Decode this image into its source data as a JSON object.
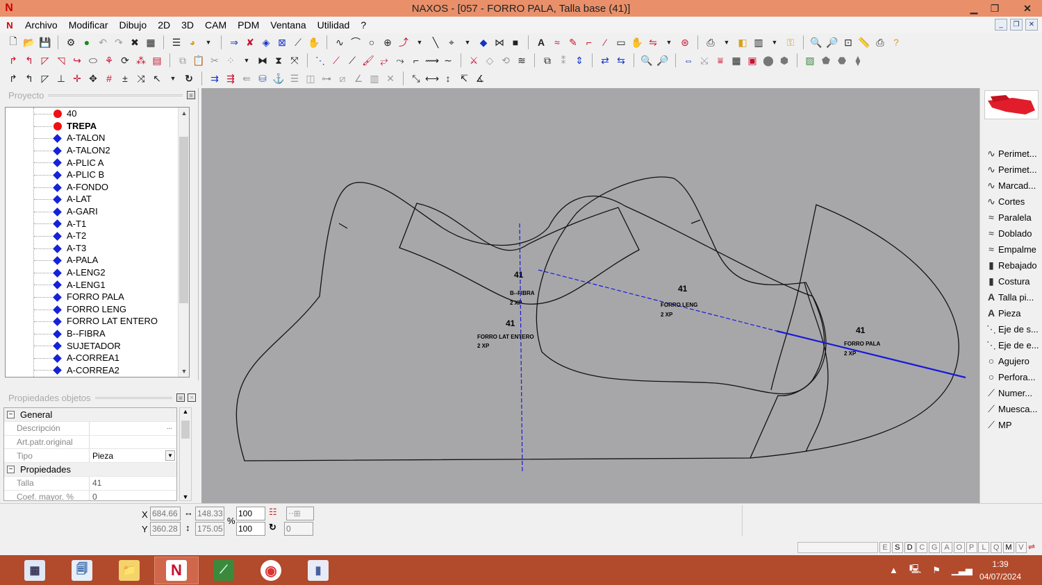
{
  "window": {
    "title": "NAXOS - [057 - FORRO PALA, Talla base (41)]",
    "app_icon": "N"
  },
  "menu": [
    "Archivo",
    "Modificar",
    "Dibujo",
    "2D",
    "3D",
    "CAM",
    "PDM",
    "Ventana",
    "Utilidad",
    "?"
  ],
  "project_panel": {
    "title": "Proyecto",
    "items": [
      {
        "label": "40",
        "marker": "red-dot",
        "bold": false
      },
      {
        "label": "TREPA",
        "marker": "red-dot",
        "bold": true
      },
      {
        "label": "A-TALON",
        "marker": "blue-diamond",
        "bold": false
      },
      {
        "label": "A-TALON2",
        "marker": "blue-diamond",
        "bold": false
      },
      {
        "label": "A-PLIC A",
        "marker": "blue-diamond",
        "bold": false
      },
      {
        "label": "A-PLIC B",
        "marker": "blue-diamond",
        "bold": false
      },
      {
        "label": "A-FONDO",
        "marker": "blue-diamond",
        "bold": false
      },
      {
        "label": "A-LAT",
        "marker": "blue-diamond",
        "bold": false
      },
      {
        "label": "A-GARI",
        "marker": "blue-diamond",
        "bold": false
      },
      {
        "label": "A-T1",
        "marker": "blue-diamond",
        "bold": false
      },
      {
        "label": "A-T2",
        "marker": "blue-diamond",
        "bold": false
      },
      {
        "label": "A-T3",
        "marker": "blue-diamond",
        "bold": false
      },
      {
        "label": "A-PALA",
        "marker": "blue-diamond",
        "bold": false
      },
      {
        "label": "A-LENG2",
        "marker": "blue-diamond",
        "bold": false
      },
      {
        "label": "A-LENG1",
        "marker": "blue-diamond",
        "bold": false
      },
      {
        "label": "FORRO PALA",
        "marker": "blue-diamond",
        "bold": false
      },
      {
        "label": "FORRO LENG",
        "marker": "blue-diamond",
        "bold": false
      },
      {
        "label": "FORRO LAT ENTERO",
        "marker": "blue-diamond",
        "bold": false
      },
      {
        "label": "B--FIBRA",
        "marker": "blue-diamond",
        "bold": false
      },
      {
        "label": "SUJETADOR",
        "marker": "blue-diamond",
        "bold": false
      },
      {
        "label": "A-CORREA1",
        "marker": "blue-diamond",
        "bold": false
      },
      {
        "label": "A-CORREA2",
        "marker": "blue-diamond",
        "bold": false
      }
    ]
  },
  "properties_panel": {
    "title": "Propiedades objetos",
    "rows": [
      {
        "type": "group",
        "label": "General"
      },
      {
        "type": "field",
        "name": "Descripción",
        "value": "",
        "control": "dots"
      },
      {
        "type": "field",
        "name": "Art.patr.original",
        "value": ""
      },
      {
        "type": "field",
        "name": "Tipo",
        "value": "Pieza",
        "control": "dropdown"
      },
      {
        "type": "group",
        "label": "Propiedades"
      },
      {
        "type": "field",
        "name": "Talla",
        "value": "41"
      },
      {
        "type": "field",
        "name": "Coef. mayor. %",
        "value": "0"
      }
    ]
  },
  "canvas": {
    "pieces": [
      {
        "size": "41",
        "name": "B--FIBRA",
        "qty": "2 XP"
      },
      {
        "size": "41",
        "name": "FORRO LAT ENTERO",
        "qty": "2 XP"
      },
      {
        "size": "41",
        "name": "FORRO LENG",
        "qty": "2 XP"
      },
      {
        "size": "41",
        "name": "FORRO PALA",
        "qty": "2 XP"
      }
    ],
    "colors": {
      "background": "#a7a7aa",
      "outline": "#111111",
      "axis": "#1a1ad8"
    }
  },
  "right_panel": {
    "tools": [
      {
        "label": "Perimet...",
        "icon": "curve-icon"
      },
      {
        "label": "Perimet...",
        "icon": "curve-icon"
      },
      {
        "label": "Marcad...",
        "icon": "curve-icon"
      },
      {
        "label": "Cortes",
        "icon": "curve-icon"
      },
      {
        "label": "Paralela",
        "icon": "parallel-icon"
      },
      {
        "label": "Doblado",
        "icon": "fold-icon"
      },
      {
        "label": "Empalme",
        "icon": "join-icon"
      },
      {
        "label": "Rebajado",
        "icon": "skive-icon"
      },
      {
        "label": "Costura",
        "icon": "seam-icon"
      },
      {
        "label": "Talla pi...",
        "icon": "text-icon"
      },
      {
        "label": "Pieza",
        "icon": "text-icon"
      },
      {
        "label": "Eje de s...",
        "icon": "axis-icon"
      },
      {
        "label": "Eje de e...",
        "icon": "axis-icon"
      },
      {
        "label": "Agujero",
        "icon": "circle-icon"
      },
      {
        "label": "Perfora...",
        "icon": "circle-icon"
      },
      {
        "label": "Numer...",
        "icon": "notch-icon"
      },
      {
        "label": "Muesca...",
        "icon": "notch-icon"
      },
      {
        "label": "MP",
        "icon": "notch-icon"
      }
    ]
  },
  "coords": {
    "x": "684.66",
    "y": "360.28",
    "width": "148.33",
    "height": "175.05",
    "scale_x": "100",
    "scale_y": "100",
    "rotation": "0",
    "x_label": "X",
    "y_label": "Y",
    "percent": "%"
  },
  "status_letters": [
    "E",
    "S",
    "D",
    "C",
    "G",
    "A",
    "O",
    "P",
    "L",
    "Q",
    "M",
    "V"
  ],
  "taskbar": {
    "time": "1:39",
    "date": "04/07/2024"
  }
}
